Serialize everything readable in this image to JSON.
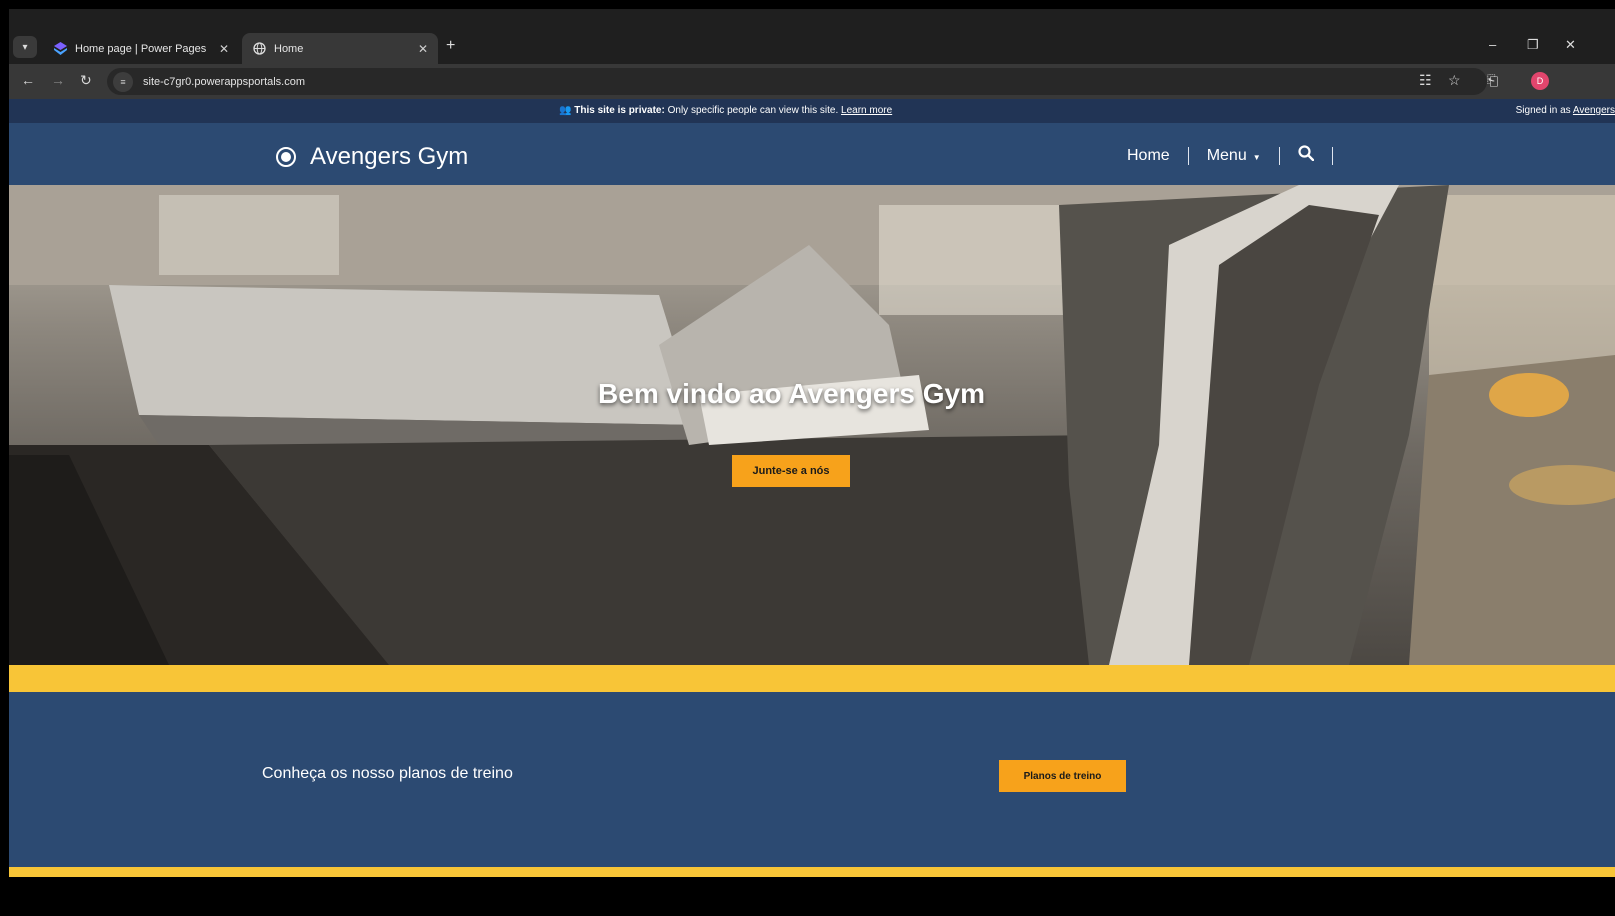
{
  "browser": {
    "tabs": [
      {
        "title": "Home page | Power Pages",
        "icon": "power-pages-icon",
        "active": false
      },
      {
        "title": "Home",
        "icon": "globe-icon",
        "active": true
      }
    ],
    "url": "site-c7gr0.powerappsportals.com",
    "profile_initial": "D"
  },
  "banner": {
    "private_label": "This site is private:",
    "message": "Only specific people can view this site.",
    "learn_more": "Learn more",
    "signed_in_prefix": "Signed in as",
    "signed_in_user": "Avengers"
  },
  "header": {
    "site_title": "Avengers Gym",
    "nav": {
      "home": "Home",
      "menu": "Menu"
    }
  },
  "hero": {
    "title": "Bem vindo ao Avengers Gym",
    "button": "Junte-se a nós"
  },
  "plans": {
    "text": "Conheça os nosso planos de treino",
    "button": "Planos de treino"
  },
  "colors": {
    "brand_blue": "#2c4a72",
    "accent_yellow": "#f8c537",
    "button_orange": "#f7a21b"
  }
}
